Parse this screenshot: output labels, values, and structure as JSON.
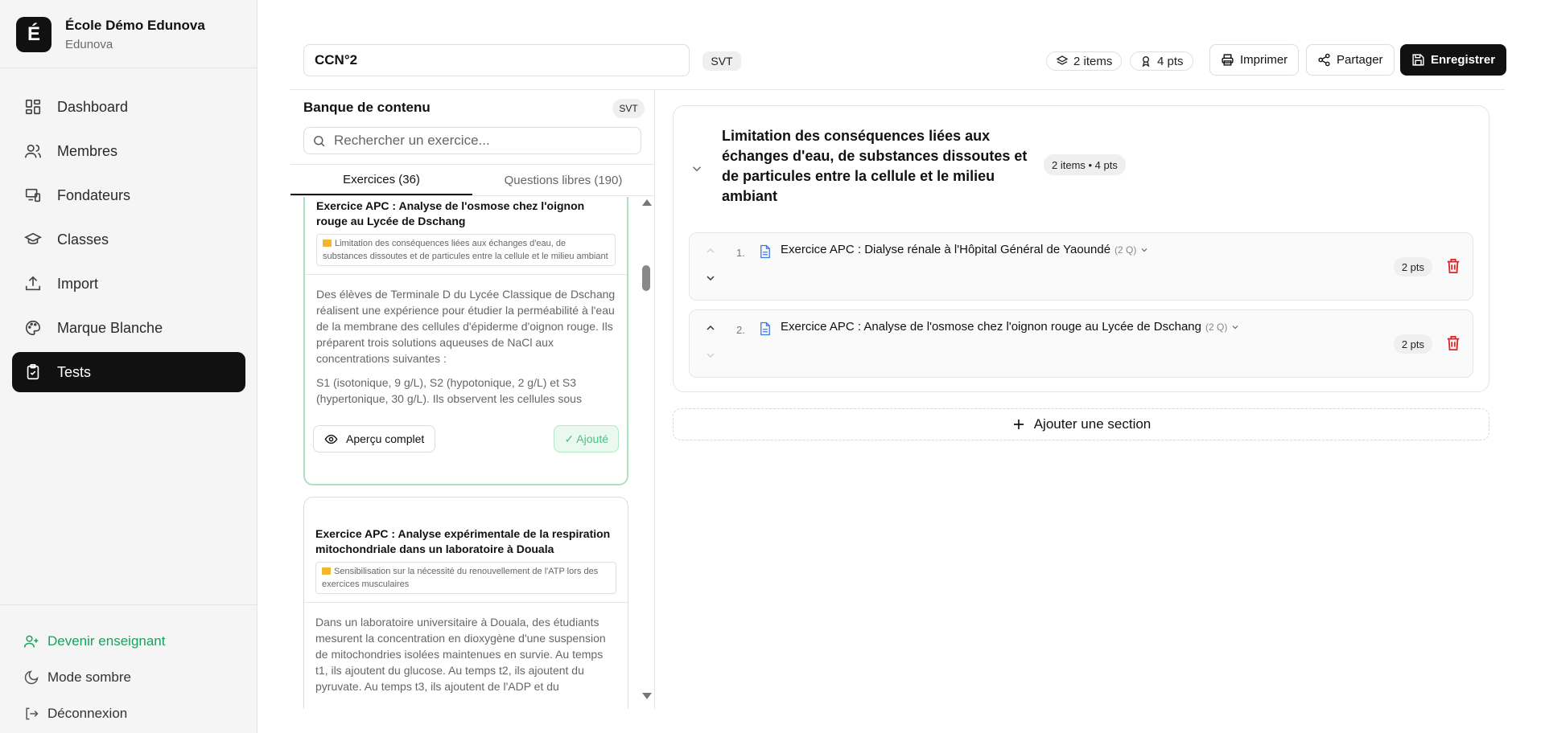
{
  "brand": {
    "logo_letter": "É",
    "name": "École Démo Edunova",
    "sub": "Edunova"
  },
  "nav": [
    {
      "label": "Dashboard",
      "icon": "dashboard-icon"
    },
    {
      "label": "Membres",
      "icon": "users-icon"
    },
    {
      "label": "Fondateurs",
      "icon": "devices-icon"
    },
    {
      "label": "Classes",
      "icon": "graduation-cap-icon"
    },
    {
      "label": "Import",
      "icon": "upload-icon"
    },
    {
      "label": "Marque Blanche",
      "icon": "palette-icon"
    },
    {
      "label": "Tests",
      "icon": "clipboard-check-icon",
      "active": true
    }
  ],
  "sidebar_bottom": {
    "become_teacher": "Devenir enseignant",
    "dark_mode": "Mode sombre",
    "logout": "Déconnexion"
  },
  "header": {
    "test_title": "CCN°2",
    "subject": "SVT",
    "items_count": "2 items",
    "points": "4 pts",
    "print_label": "Imprimer",
    "share_label": "Partager",
    "save_label": "Enregistrer"
  },
  "bank": {
    "title": "Banque de contenu",
    "subject": "SVT",
    "search_placeholder": "Rechercher un exercice...",
    "tabs": [
      "Exercices (36)",
      "Questions libres (190)"
    ],
    "cards": [
      {
        "title": "Exercice APC : Analyse de l'osmose chez l'oignon rouge au Lycée de Dschang",
        "topic": "Limitation des conséquences liées aux échanges d'eau, de substances dissoutes et de particules entre la cellule et le milieu ambiant",
        "body": [
          "Des élèves de Terminale D du Lycée Classique de Dschang réalisent une expérience pour étudier la perméabilité à l'eau de la membrane des cellules d'épiderme d'oignon rouge. Ils préparent trois solutions aqueuses de NaCl aux concentrations suivantes :",
          "S1 (isotonique, 9 g/L), S2 (hypotonique, 2 g/L) et S3 (hypertonique, 30 g/L). Ils observent les cellules sous"
        ],
        "preview_label": "Aperçu complet",
        "added_label": "✓ Ajouté"
      },
      {
        "title": "Exercice APC : Analyse expérimentale de la respiration mitochondriale dans un laboratoire à Douala",
        "topic": "Sensibilisation sur la nécessité du renouvellement de l'ATP lors des exercices musculaires",
        "body": [
          "Dans un laboratoire universitaire à Douala, des étudiants mesurent la concentration en dioxygène d'une suspension de mitochondries isolées maintenues en survie. Au temps t1, ils ajoutent du glucose. Au temps t2, ils ajoutent du pyruvate. Au temps t3, ils ajoutent de l'ADP et du"
        ]
      }
    ]
  },
  "section": {
    "title": "Limitation des conséquences liées aux échanges d'eau, de substances dissoutes et de particules entre la cellule et le milieu ambiant",
    "meta": "2 items • 4 pts",
    "items": [
      {
        "num": "1.",
        "title": "Exercice APC : Dialyse rénale à l'Hôpital Général de Yaoundé",
        "questions": "(2 Q)",
        "points": "2 pts"
      },
      {
        "num": "2.",
        "title": "Exercice APC : Analyse de l'osmose chez l'oignon rouge au Lycée de Dschang",
        "questions": "(2 Q)",
        "points": "2 pts"
      }
    ]
  },
  "add_section_label": "Ajouter une section",
  "colors": {
    "accent_dark": "#111111",
    "success": "#1aa060",
    "danger": "#e02424",
    "doc_blue": "#3b7be8"
  }
}
